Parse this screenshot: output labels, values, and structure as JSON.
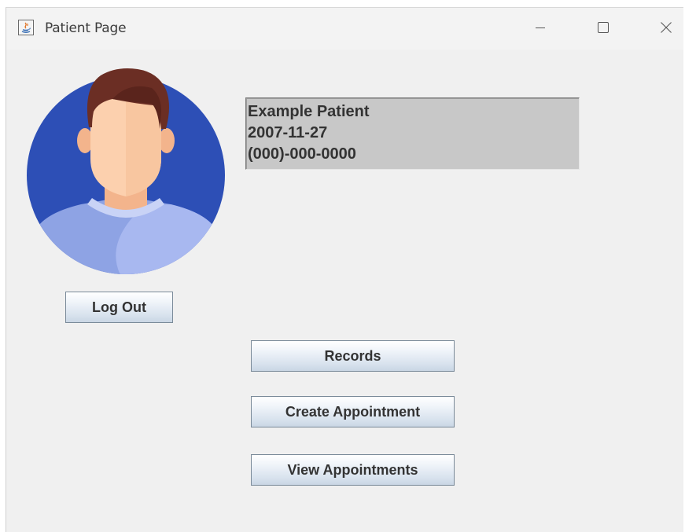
{
  "window": {
    "title": "Patient Page",
    "icons": {
      "app": "java-cup-icon",
      "minimize": "minimize-icon",
      "maximize": "maximize-icon",
      "close": "close-icon"
    }
  },
  "profile": {
    "avatar_icon": "user-avatar-icon",
    "name": "Example Patient",
    "date": "2007-11-27",
    "phone": "(000)-000-0000"
  },
  "buttons": {
    "logout": "Log Out",
    "records": "Records",
    "create_appointment": "Create Appointment",
    "view_appointments": "View Appointments"
  },
  "colors": {
    "window_bg": "#f0f0f0",
    "info_box_bg": "#c8c8c8",
    "avatar_circle": "#2d4fb6",
    "avatar_shirt": "#9fb2ea",
    "avatar_hair": "#6b2e24",
    "avatar_skin": "#f8c6a0"
  }
}
